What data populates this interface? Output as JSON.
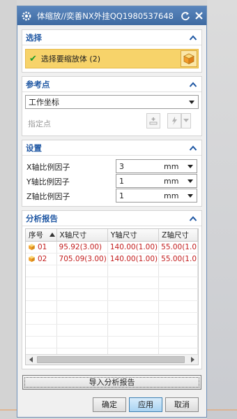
{
  "window": {
    "title": "体缩放//奕善NX外挂QQ1980537648",
    "icons": {
      "app": "gear-icon",
      "reset": "reset-icon",
      "close": "close-icon"
    }
  },
  "selection": {
    "header": "选择",
    "status_icon": "check-icon",
    "label": "选择要缩放体 (2)",
    "button_icon": "cube-icon"
  },
  "reference_point": {
    "header": "参考点",
    "dropdown_value": "工作坐标",
    "specify_label": "指定点",
    "button_icons": [
      "point-dialog-icon",
      "point-inference-icon",
      "dropdown-icon"
    ]
  },
  "settings": {
    "header": "设置",
    "fields": [
      {
        "label": "X轴比例因子",
        "value": "3",
        "unit": "mm"
      },
      {
        "label": "Y轴比例因子",
        "value": "1",
        "unit": "mm"
      },
      {
        "label": "Z轴比例因子",
        "value": "1",
        "unit": "mm"
      }
    ]
  },
  "report": {
    "header": "分析报告",
    "columns": [
      "序号",
      "X轴尺寸",
      "Y轴尺寸",
      "Z轴尺寸"
    ],
    "rows": [
      {
        "id": "01",
        "x": "95.92(3.00)",
        "y": "140.00(1.00)",
        "z": "55.00(1.0"
      },
      {
        "id": "02",
        "x": "705.09(3.00)",
        "y": "140.00(1.00)",
        "z": "55.00(1.0"
      }
    ],
    "empty_rows": 8
  },
  "buttons": {
    "import_report": "导入分析报告",
    "ok": "确定",
    "apply": "应用",
    "cancel": "取消"
  },
  "colors": {
    "title_bar": "#4a78b0",
    "section_header": "#1f57a3",
    "selection_highlight": "#f7d36a",
    "table_value_text": "#c21d1d"
  }
}
